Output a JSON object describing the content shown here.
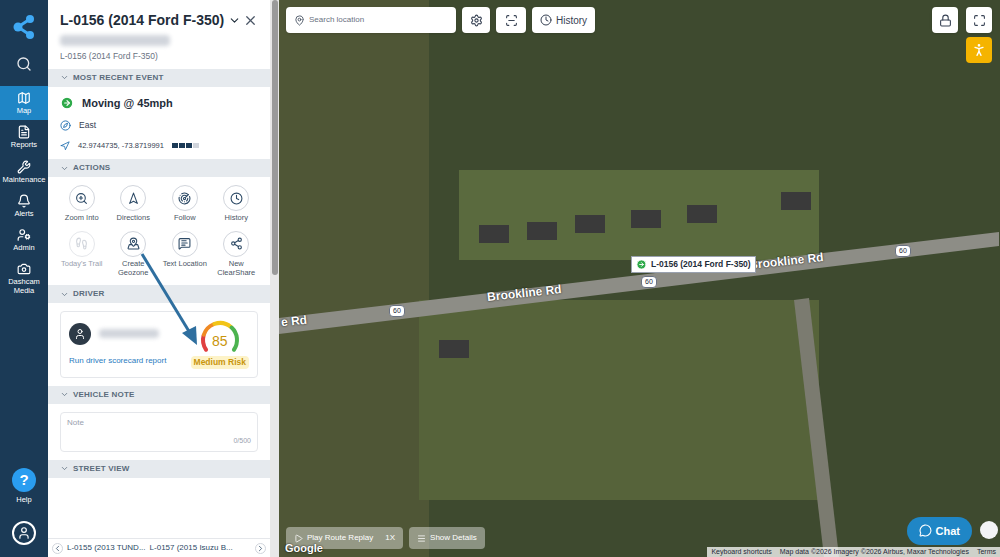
{
  "nav": {
    "items": [
      {
        "label": "Map",
        "selected": true
      },
      {
        "label": "Reports",
        "selected": false
      },
      {
        "label": "Maintenance",
        "selected": false
      },
      {
        "label": "Alerts",
        "selected": false
      },
      {
        "label": "Admin",
        "selected": false
      },
      {
        "label": "Dashcam Media",
        "selected": false
      }
    ],
    "help": "Help"
  },
  "panel": {
    "title": "L-0156 (2014 Ford F-350)",
    "subtitle": "L-0156 (2014 Ford F-350)"
  },
  "event": {
    "header": "MOST RECENT EVENT",
    "status": "Moving @ 45mph",
    "heading": "East",
    "coordinates": "42.9744735, -73.8719991",
    "signal_level": 0.75
  },
  "actions": {
    "header": "ACTIONS",
    "items": [
      {
        "label": "Zoom Into",
        "disabled": false
      },
      {
        "label": "Directions",
        "disabled": false
      },
      {
        "label": "Follow",
        "disabled": false
      },
      {
        "label": "History",
        "disabled": false
      },
      {
        "label": "Today's Trail",
        "disabled": true
      },
      {
        "label": "Create Geozone",
        "disabled": false
      },
      {
        "label": "Text Location",
        "disabled": false
      },
      {
        "label": "New ClearShare",
        "disabled": false
      }
    ]
  },
  "driver": {
    "header": "DRIVER",
    "link": "Run driver scorecard report",
    "score": "85",
    "risk": "Medium Risk"
  },
  "vehicle_note": {
    "header": "VEHICLE NOTE",
    "placeholder": "Note",
    "count": "0/500"
  },
  "street_view": {
    "header": "STREET VIEW"
  },
  "pager": {
    "previous": "L-0155 (2013 TUND...",
    "next": "L-0157 (2015 Isuzu B..."
  },
  "map": {
    "search_placeholder": "Search location",
    "history_button": "History",
    "marker_label": "L-0156 (2014 Ford F-350)",
    "road_labels": [
      "e Rd",
      "Brookline Rd",
      "Brookline Rd"
    ],
    "route_shields": [
      "60",
      "60",
      "60"
    ],
    "replay_button": "Play Route Replay",
    "speed": "1X",
    "details_button": "Show Details",
    "google_logo": "Google",
    "attribution": [
      "Keyboard shortcuts",
      "Map data ©2026 Imagery ©2026 Airbus, Maxar Technologies",
      "Terms"
    ],
    "chat_button": "Chat"
  }
}
